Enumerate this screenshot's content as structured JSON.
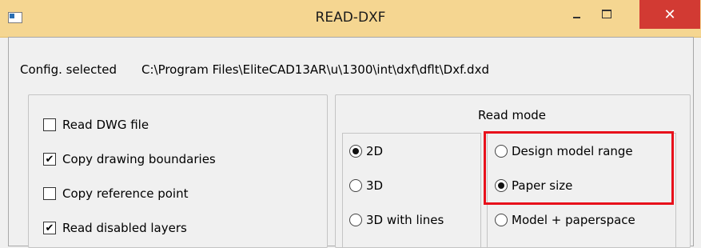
{
  "window": {
    "title": "READ-DXF",
    "close_glyph": "✕"
  },
  "config": {
    "label": "Config. selected",
    "path": "C:\\Program Files\\EliteCAD13AR\\u\\1300\\int\\dxf\\dflt\\Dxf.dxd"
  },
  "options": [
    {
      "label": "Read DWG file",
      "checked": false
    },
    {
      "label": "Copy drawing boundaries",
      "checked": true
    },
    {
      "label": "Copy reference point",
      "checked": false
    },
    {
      "label": "Read disabled layers",
      "checked": true
    }
  ],
  "read_mode": {
    "label": "Read mode",
    "dimension": [
      {
        "label": "2D",
        "selected": true
      },
      {
        "label": "3D",
        "selected": false
      },
      {
        "label": "3D with lines",
        "selected": false
      }
    ],
    "range": [
      {
        "label": "Design model range",
        "selected": false
      },
      {
        "label": "Paper size",
        "selected": true
      },
      {
        "label": "Model + paperspace",
        "selected": false
      }
    ]
  },
  "colors": {
    "titlebar": "#f5d691",
    "close": "#d23a33",
    "highlight": "#e8101b"
  },
  "checkmark": "✔"
}
